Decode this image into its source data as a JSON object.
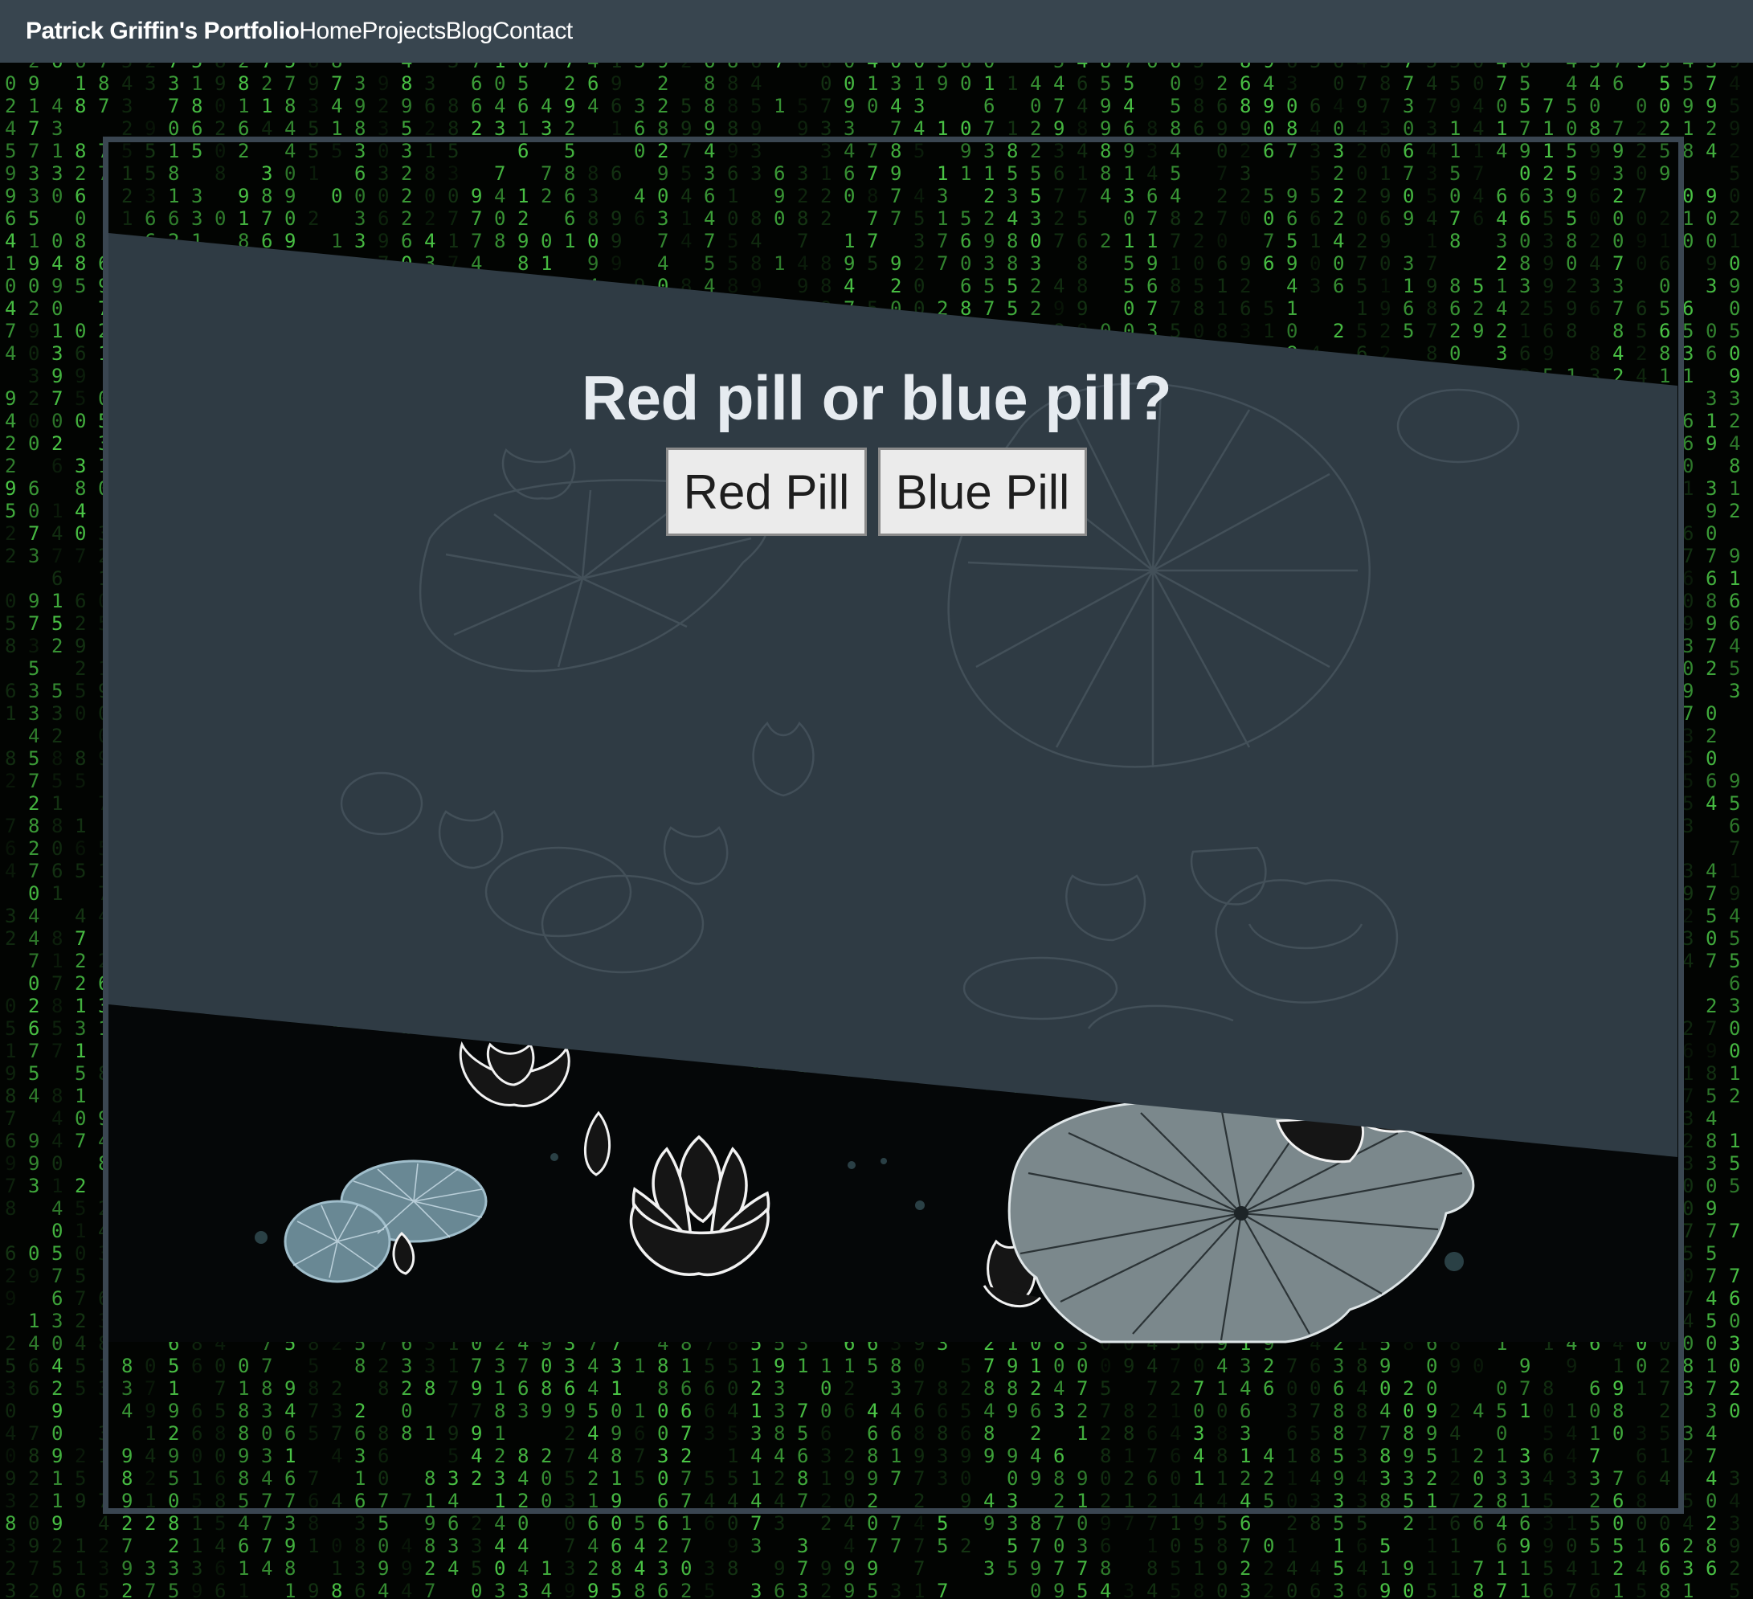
{
  "nav": {
    "brand": "Patrick Griffin's Portfolio",
    "links": [
      "Home",
      "Projects",
      "Blog",
      "Contact"
    ]
  },
  "main": {
    "question": "Red pill or blue pill?",
    "buttons": {
      "red": "Red Pill",
      "blue": "Blue Pill"
    }
  },
  "colors": {
    "navbar_bg": "#38454f",
    "panel_bg": "#2f3b44",
    "frame_border": "#3a4651",
    "matrix_green": "#4fd14a",
    "page_bg": "#020402"
  },
  "icons": [
    "lotus-illustration-icon",
    "lily-pad-icon"
  ]
}
